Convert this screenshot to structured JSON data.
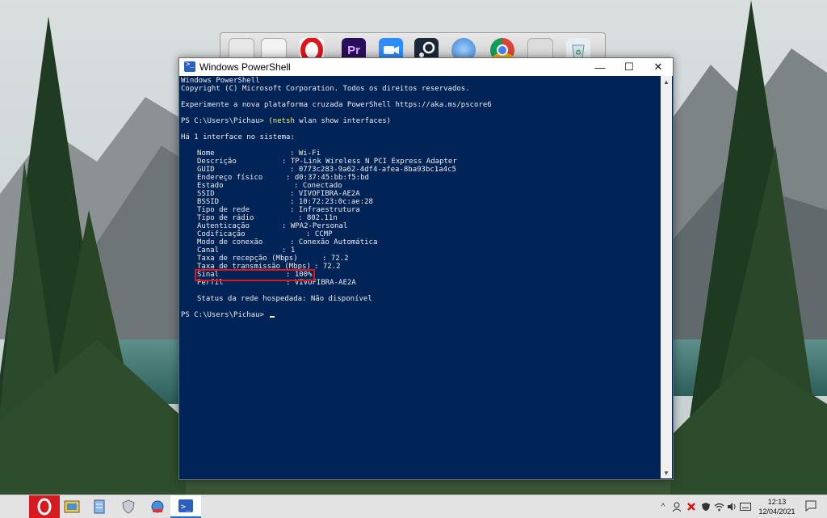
{
  "window": {
    "title": "Windows PowerShell",
    "minimize_glyph": "—",
    "maximize_glyph": "☐",
    "close_glyph": "✕"
  },
  "console": {
    "header": [
      "Windows PowerShell",
      "Copyright (C) Microsoft Corporation. Todos os direitos reservados.",
      "",
      "Experimente a nova plataforma cruzada PowerShell https://aka.ms/pscore6"
    ],
    "prompt1": "PS C:\\Users\\Pichau> ",
    "command_name": "(netsh",
    "command_args": " wlan show interfaces)",
    "interface_count": "Há 1 interface no sistema:",
    "fields": [
      {
        "key": "Nome",
        "value": ": Wi-Fi"
      },
      {
        "key": "Descrição",
        "value": ": TP-Link Wireless N PCI Express Adapter"
      },
      {
        "key": "GUID",
        "value": ": 0773c283-9a62-4df4-afea-8ba93bc1a4c5"
      },
      {
        "key": "Endereço físico",
        "value": ": d0:37:45:bb:f5:bd"
      },
      {
        "key": "Estado",
        "value": ": Conectado"
      },
      {
        "key": "SSID",
        "value": ": VIVOFIBRA-AE2A"
      },
      {
        "key": "BSSID",
        "value": ": 10:72:23:0c:ae:28"
      },
      {
        "key": "Tipo de rede",
        "value": ": Infraestrutura"
      },
      {
        "key": "Tipo de rádio",
        "value": ": 802.11n"
      },
      {
        "key": "Autenticação",
        "value": ": WPA2-Personal"
      },
      {
        "key": "Codificação",
        "value": ": CCMP"
      },
      {
        "key": "Modo de conexão",
        "value": ": Conexão Automática"
      },
      {
        "key": "Canal",
        "value": ": 1"
      },
      {
        "key": "Taxa de recepção (Mbps)",
        "value": ": 72.2"
      },
      {
        "key": "Taxa de transmissão (Mbps)",
        "value": ": 72.2"
      },
      {
        "key": "Sinal",
        "value": ": 100%"
      },
      {
        "key": "Perfil",
        "value": ": VIVOFIBRA-AE2A"
      }
    ],
    "hosted_status": "Status da rede hospedada: Não disponível",
    "prompt2": "PS C:\\Users\\Pichau> "
  },
  "dock": {
    "icons": [
      "documents-icon",
      "notes-icon",
      "opera-icon",
      "premiere-icon",
      "zoom-icon",
      "steam-icon",
      "network-globe-icon",
      "chrome-icon",
      "apps-icon",
      "recycle-bin-icon"
    ]
  },
  "taskbar": {
    "apps": [
      "opera-icon",
      "image-viewer-icon",
      "notepad-icon",
      "security-icon",
      "network-icon",
      "powershell-icon"
    ],
    "tray_chevron": "^",
    "time": "12:13",
    "date": "12/04/2021"
  },
  "colors": {
    "console_bg": "#012456",
    "console_text": "#eeedf0",
    "command_yellow": "#f8f46a",
    "highlight_red": "#e11515"
  }
}
